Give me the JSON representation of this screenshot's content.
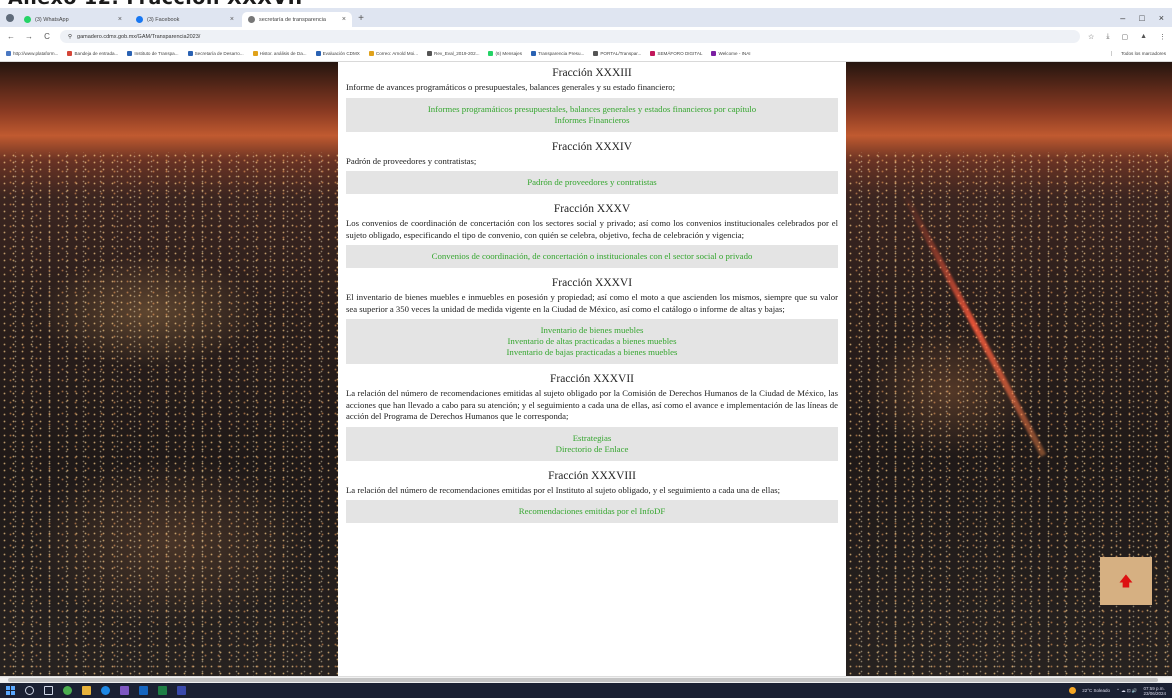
{
  "slide_heading": "Anexo 12. Fracción XXXVII",
  "browser": {
    "tabs": [
      {
        "title": "(3) WhatsApp",
        "favicon_color": "#25d366",
        "active": false
      },
      {
        "title": "(3) Facebook",
        "favicon_color": "#1877f2",
        "active": false
      },
      {
        "title": "secretaría de transparencia",
        "favicon_color": "#777777",
        "active": true
      }
    ],
    "new_tab": "+",
    "window_controls": [
      "–",
      "□",
      "×"
    ],
    "nav": {
      "back": "←",
      "forward": "→",
      "reload": "C",
      "site_info": "⚲"
    },
    "url": "gamadero.cdmx.gob.mx/GAM/Transparencia2023/",
    "addr_right": [
      "☆",
      "⤓",
      "▢",
      "▲",
      "⋮"
    ],
    "bookmarks": [
      "http://www.plataform...",
      "Bandeja de entrada...",
      "Instituto de Transpa...",
      "Secretaría de Desarro...",
      "Histor. análisis de Da...",
      "Evaluación CDMX",
      "Correo: Arnold Moi...",
      "Rev_Eval_2019-202...",
      "(6) Mensajes",
      "Transparencia Presu...",
      "PORTAL/Transpar...",
      "SEMÁFORO DIGITAL",
      "Welcome - INAI"
    ],
    "bookmarks_right": "Todos los marcadores"
  },
  "sections": [
    {
      "title": "Fracción XXXIII",
      "description": "Informe de avances programáticos o presupuestales, balances generales y su estado financiero;",
      "links": [
        "Informes programáticos presupuestales, balances generales y estados financieros por capítulo",
        "Informes Financieros"
      ]
    },
    {
      "title": "Fracción XXXIV",
      "description": "Padrón de proveedores y contratistas;",
      "links": [
        "Padrón de proveedores y contratistas"
      ]
    },
    {
      "title": "Fracción XXXV",
      "description": "Los convenios de coordinación de concertación con los sectores social y privado; así como los convenios institucionales celebrados por el sujeto obligado, especificando el tipo de convenio, con quién se celebra, objetivo, fecha de celebración y vigencia;",
      "links": [
        "Convenios de coordinación, de concertación o institucionales con el sector social o privado"
      ]
    },
    {
      "title": "Fracción XXXVI",
      "description": "El inventario de bienes muebles e inmuebles en posesión y propiedad; así como el moto a que ascienden los mismos, siempre que su valor sea superior a 350 veces la unidad de medida vigente en la Ciudad de México, así como el catálogo o informe de altas y bajas;",
      "links": [
        "Inventario de bienes muebles",
        "Inventario de altas practicadas a bienes muebles",
        "Inventario de bajas practicadas a bienes muebles"
      ]
    },
    {
      "title": "Fracción XXXVII",
      "description": "La relación del número de recomendaciones emitidas al sujeto obligado por la Comisión de Derechos Humanos de la Ciudad de México, las acciones que han llevado a cabo para su atención; y el seguimiento a cada una de ellas, así como el avance e implementación de las líneas de acción del Programa de Derechos Humanos que le corresponda;",
      "links": [
        "Estrategias",
        "Directorio de Enlace"
      ]
    },
    {
      "title": "Fracción XXXVIII",
      "description": "La relación del número de recomendaciones emitidas por el Instituto al sujeto obligado, y el seguimiento a cada una de ellas;",
      "links": [
        "Recomendaciones emitidas por el InfoDF"
      ]
    }
  ],
  "scroll_top_icon": "arrow-up-icon",
  "scroll_top_glyph": "🡅",
  "colors": {
    "link_green": "#35a62f",
    "linkbox_bg": "#e4e4e4",
    "totop_bg": "#d6b082"
  },
  "taskbar": {
    "weather": "22°C Soleado",
    "time": "07:59 p.m.",
    "date": "23/06/2024"
  }
}
